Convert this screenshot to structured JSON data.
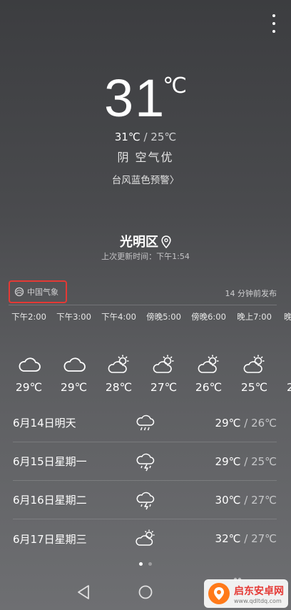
{
  "current": {
    "temp": "31",
    "unit": "℃",
    "high": "31℃",
    "separator": " / ",
    "low": "25℃",
    "condition": "阴  空气优",
    "alert": "台风蓝色预警",
    "alert_chevron": "〉"
  },
  "location": {
    "name": "光明区",
    "updated": "上次更新时间：下午1:54"
  },
  "source": {
    "label": "中国气象",
    "published": "14 分钟前发布"
  },
  "hourly": [
    {
      "time": "下午2:00",
      "icon": "cloudy-icon",
      "temp": "29℃"
    },
    {
      "time": "下午3:00",
      "icon": "cloudy-icon",
      "temp": "29℃"
    },
    {
      "time": "下午4:00",
      "icon": "partly-cloudy-icon",
      "temp": "28℃"
    },
    {
      "time": "傍晚5:00",
      "icon": "partly-cloudy-icon",
      "temp": "27℃"
    },
    {
      "time": "傍晚6:00",
      "icon": "partly-cloudy-icon",
      "temp": "26℃"
    },
    {
      "time": "晚上7:00",
      "icon": "partly-cloudy-icon",
      "temp": "25℃"
    },
    {
      "time": "晚",
      "icon": "partly-cloudy-icon",
      "temp": "2"
    }
  ],
  "daily": [
    {
      "date": "6月14日明天",
      "icon": "rain-icon",
      "high": "29℃",
      "sep": " / ",
      "low": "26℃"
    },
    {
      "date": "6月15日星期一",
      "icon": "thunderstorm-icon",
      "high": "29℃",
      "sep": " / ",
      "low": "25℃"
    },
    {
      "date": "6月16日星期二",
      "icon": "thunderstorm-icon",
      "high": "30℃",
      "sep": " / ",
      "low": "27℃"
    },
    {
      "date": "6月17日星期三",
      "icon": "partly-cloudy-icon",
      "high": "32℃",
      "sep": " / ",
      "low": "27℃"
    }
  ],
  "watermark": {
    "title": "启东安卓网",
    "url": "www.qdltdq.com"
  }
}
